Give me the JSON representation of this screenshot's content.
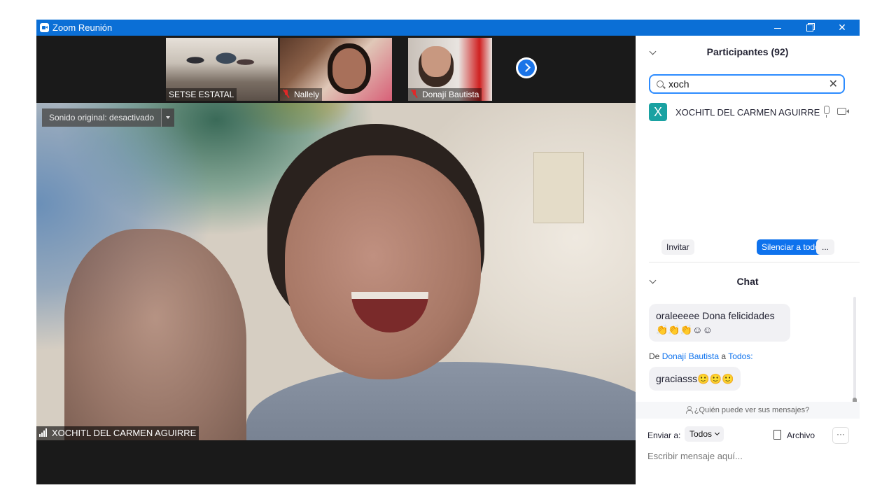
{
  "window": {
    "title": "Zoom Reunión",
    "icons": {
      "app": "zoom-camera-icon",
      "minimize": "minimize-icon",
      "maximize": "restore-icon",
      "close": "close-icon"
    },
    "close_glyph": "✕"
  },
  "video_strip": {
    "thumbnails": [
      {
        "name": "SETSE ESTATAL",
        "muted": false
      },
      {
        "name": "Nallely",
        "muted": true
      },
      {
        "name": "Donají Bautista",
        "muted": true
      }
    ],
    "next_icon": "chevron-right-circle-icon"
  },
  "main_video": {
    "sound_label": "Sonido original: desactivado",
    "speaker_name": "XOCHITL DEL CARMEN AGUIRRE"
  },
  "participants": {
    "title": "Participantes (92)",
    "search_value": "xoch",
    "clear_glyph": "✕",
    "list": [
      {
        "initial": "X",
        "name": "XOCHITL DEL CARMEN AGUIRRE",
        "avatar_color": "#1aa2a2"
      }
    ],
    "buttons": {
      "invite": "Invitar",
      "mute_all": "Silenciar a todos",
      "more": "..."
    }
  },
  "chat": {
    "title": "Chat",
    "messages": [
      {
        "text": "oraleeeee Dona felicidades 👏👏👏☺☺"
      },
      {
        "from_prefix": "De",
        "from": "Donají Bautista",
        "to_prefix": "a",
        "to": "Todos:",
        "text": "graciasss🙂🙂🙂"
      }
    ],
    "who_can_see": "¿Quién puede ver sus mensajes?",
    "send_to_label": "Enviar a:",
    "send_to_value": "Todos",
    "file_label": "Archivo",
    "more": "···",
    "input_placeholder": "Escribir mensaje aquí..."
  },
  "colors": {
    "titlebar": "#0b6fd6",
    "accent": "#0e72ed",
    "avatar": "#1aa2a2",
    "muted_mic": "#e02828"
  }
}
